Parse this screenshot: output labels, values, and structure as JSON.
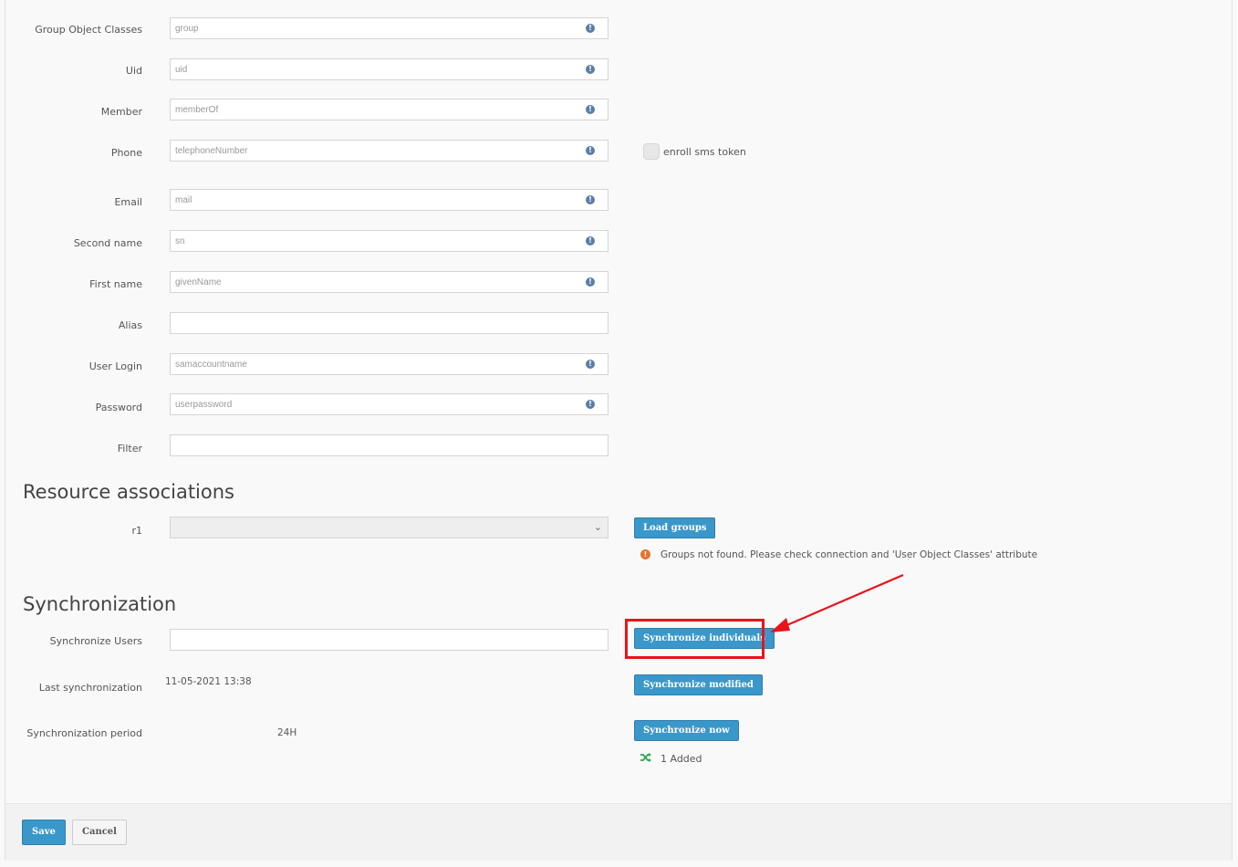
{
  "form": {
    "fields": [
      {
        "label": "Group Object Classes",
        "value": "group",
        "info": true
      },
      {
        "label": "Uid",
        "value": "uid",
        "info": true
      },
      {
        "label": "Member",
        "value": "memberOf",
        "info": true
      },
      {
        "label": "Phone",
        "value": "telephoneNumber",
        "info": true
      },
      {
        "label": "Email",
        "value": "mail",
        "info": true
      },
      {
        "label": "Second name",
        "value": "sn",
        "info": true
      },
      {
        "label": "First name",
        "value": "givenName",
        "info": true
      },
      {
        "label": "Alias",
        "value": "",
        "info": false
      },
      {
        "label": "User Login",
        "value": "samaccountname",
        "info": true
      },
      {
        "label": "Password",
        "value": "userpassword",
        "info": true
      },
      {
        "label": "Filter",
        "value": "",
        "info": false
      }
    ],
    "enroll_sms_label": "enroll sms token"
  },
  "resources": {
    "heading": "Resource associations",
    "r1_label": "r1",
    "load_groups_label": "Load groups",
    "warning_text": "Groups not found. Please check connection and 'User Object Classes' attribute"
  },
  "sync": {
    "heading": "Synchronization",
    "users_label": "Synchronize Users",
    "users_value": "",
    "last_label": "Last synchronization",
    "last_value": "11-05-2021 13:38",
    "period_label": "Synchronization period",
    "period_value": "24H",
    "individuals_label": "Synchronize individuals",
    "modified_label": "Synchronize modified",
    "now_label": "Synchronize now",
    "result_text": "1 Added"
  },
  "footer": {
    "save_label": "Save",
    "cancel_label": "Cancel"
  },
  "colors": {
    "primary_button": "#3a97c9",
    "highlight": "#e8141b",
    "warning": "#e8732c",
    "success": "#2ea84a",
    "info_icon": "#5a7ea8"
  }
}
